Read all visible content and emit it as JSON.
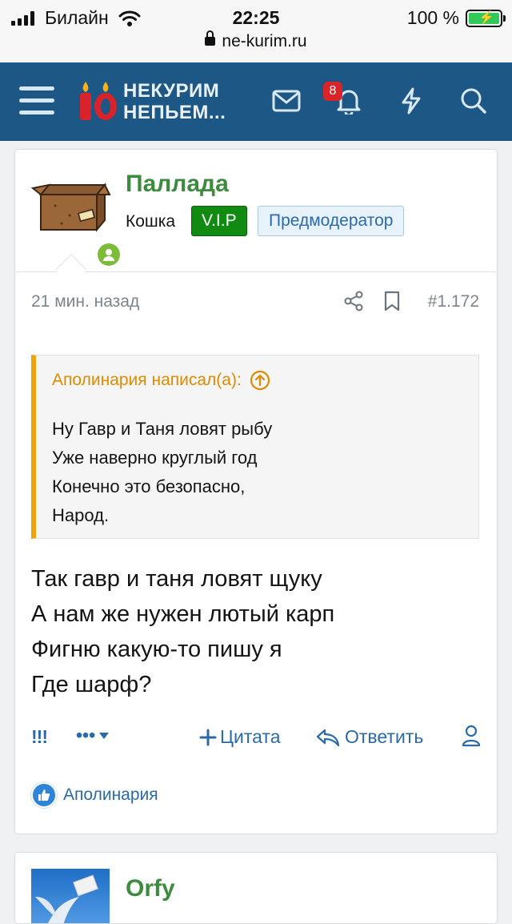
{
  "status_bar": {
    "carrier": "Билайн",
    "time": "22:25",
    "battery_percent": "100 %",
    "url": "ne-kurim.ru"
  },
  "header": {
    "logo_line1": "НЕКУРИМ",
    "logo_line2": "НЕПЬЕМ...",
    "logo_digits": "10",
    "notification_count": "8"
  },
  "post": {
    "username": "Паллада",
    "user_title": "Кошка",
    "banners": [
      "V.I.P",
      "Предмодератор"
    ],
    "time": "21 мин. назад",
    "post_number": "#1.172",
    "quote": {
      "author_line": "Аполинария написал(а):",
      "lines": [
        "Ну Гавр и Таня ловят рыбу",
        "Уже наверно круглый год",
        "Конечно это безопасно,",
        "Народ."
      ]
    },
    "message_lines": [
      "Так гавр и таня ловят щуку",
      "А нам же нужен лютый карп",
      "Фигню какую-то пишу я",
      "Где шарф?"
    ],
    "actions": {
      "exclaim": "!!!",
      "more": "•••",
      "quote": "Цитата",
      "reply": "Ответить"
    },
    "reaction_user": "Аполинария"
  },
  "next_post": {
    "username": "Orfy"
  },
  "colors": {
    "header_bg": "#1c5785",
    "username": "#3d8b3d",
    "link": "#2b6aa8",
    "quote_accent": "#f0a30a",
    "vip_bg": "#118a11"
  }
}
